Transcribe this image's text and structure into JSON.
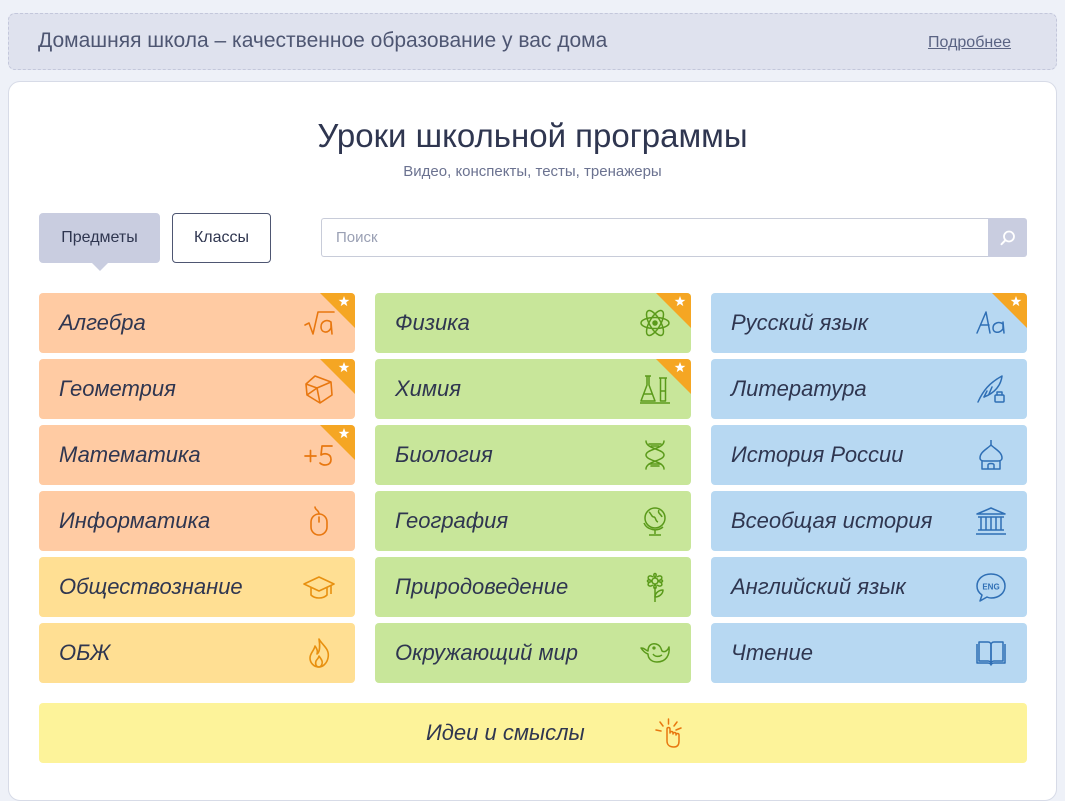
{
  "banner": {
    "title": "Домашняя школа – качественное образование у вас дома",
    "link": "Подробнее"
  },
  "header": {
    "title": "Уроки школьной программы",
    "subtitle": "Видео, конспекты, тесты, тренажеры"
  },
  "tabs": {
    "subjects": "Предметы",
    "classes": "Классы",
    "active": "subjects"
  },
  "search": {
    "placeholder": "Поиск",
    "value": ""
  },
  "colors": {
    "orange": "#ffcba3",
    "yellow": "#ffdf93",
    "green": "#c8e69a",
    "blue": "#b7d8f2",
    "wide": "#fdf39a",
    "star": "#f5a623"
  },
  "subjects": {
    "col1": [
      {
        "label": "Алгебра",
        "icon": "sqrt-icon",
        "star": true,
        "color": "orange"
      },
      {
        "label": "Геометрия",
        "icon": "polyhedron-icon",
        "star": true,
        "color": "orange"
      },
      {
        "label": "Математика",
        "icon": "plus-five-icon",
        "star": true,
        "color": "orange"
      },
      {
        "label": "Информатика",
        "icon": "mouse-icon",
        "star": false,
        "color": "orange"
      },
      {
        "label": "Обществознание",
        "icon": "graduation-cap-icon",
        "star": false,
        "color": "yellow"
      },
      {
        "label": "ОБЖ",
        "icon": "flame-icon",
        "star": false,
        "color": "yellow"
      }
    ],
    "col2": [
      {
        "label": "Физика",
        "icon": "atom-icon",
        "star": true,
        "color": "green"
      },
      {
        "label": "Химия",
        "icon": "flask-icon",
        "star": true,
        "color": "green"
      },
      {
        "label": "Биология",
        "icon": "dna-icon",
        "star": false,
        "color": "green"
      },
      {
        "label": "География",
        "icon": "globe-icon",
        "star": false,
        "color": "green"
      },
      {
        "label": "Природоведение",
        "icon": "flower-icon",
        "star": false,
        "color": "green"
      },
      {
        "label": "Окружающий мир",
        "icon": "bird-icon",
        "star": false,
        "color": "green"
      }
    ],
    "col3": [
      {
        "label": "Русский язык",
        "icon": "letters-aa-icon",
        "star": true,
        "color": "blue"
      },
      {
        "label": "Литература",
        "icon": "quill-icon",
        "star": false,
        "color": "blue"
      },
      {
        "label": "История России",
        "icon": "onion-dome-icon",
        "star": false,
        "color": "blue"
      },
      {
        "label": "Всеобщая история",
        "icon": "temple-icon",
        "star": false,
        "color": "blue"
      },
      {
        "label": "Английский язык",
        "icon": "eng-bubble-icon",
        "star": false,
        "color": "blue"
      },
      {
        "label": "Чтение",
        "icon": "book-icon",
        "star": false,
        "color": "blue"
      }
    ]
  },
  "wide": {
    "label": "Идеи и смыслы",
    "icon": "idea-hand-icon"
  }
}
